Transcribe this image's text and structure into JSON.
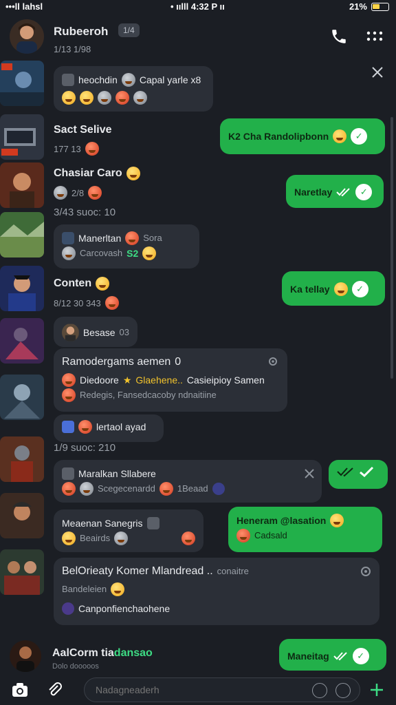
{
  "status_bar": {
    "carrier": "•••ll lahsl",
    "time": "• ıılll 4:32 P ıı",
    "battery": "21%"
  },
  "header": {
    "name": "Rubeeroh",
    "badge": "1/4",
    "subtitle": "1/13  1/98"
  },
  "messages": {
    "m1": {
      "text": "heochdin",
      "text2": "Capal yarle x8"
    },
    "m2": {
      "name": "Sact Selive",
      "meta": "177  13"
    },
    "m3": {
      "text": "K2 Cha Randolipbonn"
    },
    "m4": {
      "name": "Chasiar Caro",
      "meta": "2/8"
    },
    "m5": {
      "text": "Naretlay"
    },
    "m6": {
      "meta": "3/43  suoc:  10"
    },
    "m7": {
      "line1": "Manerltan",
      "line1b": "Sora",
      "line2": "Carcovash",
      "line2b": "S2"
    },
    "m8": {
      "name": "Conten",
      "meta": "8/12  30  343"
    },
    "m9": {
      "text": "Ka tellay"
    },
    "m10": {
      "text": "Besase",
      "text2": "03"
    },
    "m11": {
      "title": "Ramodergams aemen",
      "title_suffix": "0",
      "line1": "Diedoore",
      "line1_accent": "Glaehene..",
      "line1_rest": "Casieipioy Samen",
      "line2": "Redegis, Fansedcacoby ndnaitiine"
    },
    "m12": {
      "text": "lertaol ayad"
    },
    "m13": {
      "meta": "1/9  suoc:  210"
    },
    "m14": {
      "line1": "Maralkan Sllabere",
      "line2": "Scegecenardd",
      "line2b": "1Beaad"
    },
    "m15": {
      "name": "Meaenan Sanegris",
      "meta": "Beairds"
    },
    "m16": {
      "line1": "Heneram @lasation",
      "line2": "Cadsald"
    },
    "m17": {
      "title": "BelOrieaty Komer Mlandread ..",
      "title_suffix": "conaitre",
      "line1": "Bandeleien",
      "line2": "Canponfienchaohene"
    }
  },
  "bottom_contact": {
    "name": "AalCorm tia",
    "name_accent": "dansao",
    "subtitle": "Dolo dooooos",
    "reply": "Maneitag"
  },
  "composer": {
    "placeholder": "Nadagneaderh"
  },
  "colors": {
    "background": "#1b1e24",
    "incoming": "#2b2f37",
    "outgoing": "#22b04a",
    "accent": "#3ddc84"
  }
}
